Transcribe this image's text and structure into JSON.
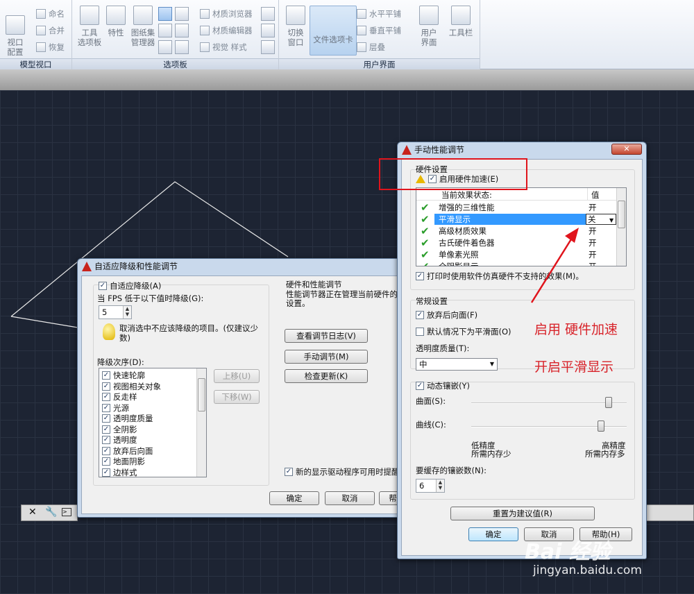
{
  "ribbon": {
    "viewport_config": "视口\n配置",
    "named": "命名",
    "merge": "合并",
    "restore": "恢复",
    "tool_palette": "工具\n选项板",
    "properties": "特性",
    "sheet_set": "图纸集\n管理器",
    "material_browser": "材质浏览器",
    "material_editor": "材质编辑器",
    "visual_styles": "视觉 样式",
    "switch_window": "切换\n窗口",
    "file_tabs": "文件选项卡",
    "tile_horizontal": "水平平铺",
    "tile_vertical": "垂直平铺",
    "cascade": "层叠",
    "user_interface": "用户\n界面",
    "toolbar": "工具栏",
    "group_model_viewports": "模型视口",
    "group_palettes": "选项板",
    "group_user_interface": "用户界面"
  },
  "adaptive_dialog": {
    "title": "自适应降级和性能调节",
    "adaptive_degradation_label": "自适应降级(A)",
    "fps_label": "当 FPS 低于以下值时降级(G):",
    "fps_value": "5",
    "tip_text": "取消选中不应该降级的项目。(仅建议少数)",
    "order_label": "降级次序(D):",
    "order_items": [
      "快速轮廓",
      "视图相关对象",
      "反走样",
      "光源",
      "透明度质量",
      "全阴影",
      "透明度",
      "放弃后向面",
      "地面阴影",
      "边样式"
    ],
    "move_up": "上移(U)",
    "move_down": "下移(W)",
    "hw_group_label": "硬件和性能调节",
    "hw_group_text": "性能调节器正在管理当前硬件的设置。",
    "view_log": "查看调节日志(V)",
    "manual_tune": "手动调节(M)",
    "check_updates": "检查更新(K)",
    "driver_notify": "新的显示驱动程序可用时提醒",
    "ok": "确定",
    "cancel": "取消",
    "help_partial": "帮"
  },
  "manual_dialog": {
    "title": "手动性能调节",
    "close": "✕",
    "hw_settings_label": "硬件设置",
    "enable_hw_accel": "启用硬件加速(E)",
    "col_effect": "当前效果状态:",
    "col_value": "值",
    "effects": [
      {
        "name": "增强的三维性能",
        "value": "开"
      },
      {
        "name": "平滑显示",
        "value": "关"
      },
      {
        "name": "高级材质效果",
        "value": "开"
      },
      {
        "name": "古氏硬件着色器",
        "value": "开"
      },
      {
        "name": "单像素光照",
        "value": "开"
      },
      {
        "name": "全阴影显示",
        "value": "开"
      }
    ],
    "emulate_label": "打印时使用软件仿真硬件不支持的效果(M)。",
    "general_label": "常规设置",
    "discard_back_faces": "放弃后向面(F)",
    "smooth_default": "默认情况下为平滑面(O)",
    "transparency_label": "透明度质量(T):",
    "transparency_value": "中",
    "dynamic_tess": "动态镶嵌(Y)",
    "surface_label": "曲面(S):",
    "curve_label": "曲线(C):",
    "low_precision": "低精度",
    "less_memory": "所需内存少",
    "high_precision": "高精度",
    "more_memory": "所需内存多",
    "cache_label": "要缓存的镶嵌数(N):",
    "cache_value": "6",
    "reset": "重置为建议值(R)",
    "ok": "确定",
    "cancel": "取消",
    "help": "帮助(H)",
    "surface_level": 0.9,
    "curve_level": 0.85
  },
  "annotations": {
    "enable_hw": "启用 硬件加速",
    "enable_smooth": "开启平滑显示"
  },
  "watermark": {
    "brand": "Bai  经验",
    "url": "jingyan.baidu.com"
  },
  "colors": {
    "annotation_red": "#d8232a",
    "selection_blue": "#3399ff",
    "check_green": "#2a9d2a"
  }
}
